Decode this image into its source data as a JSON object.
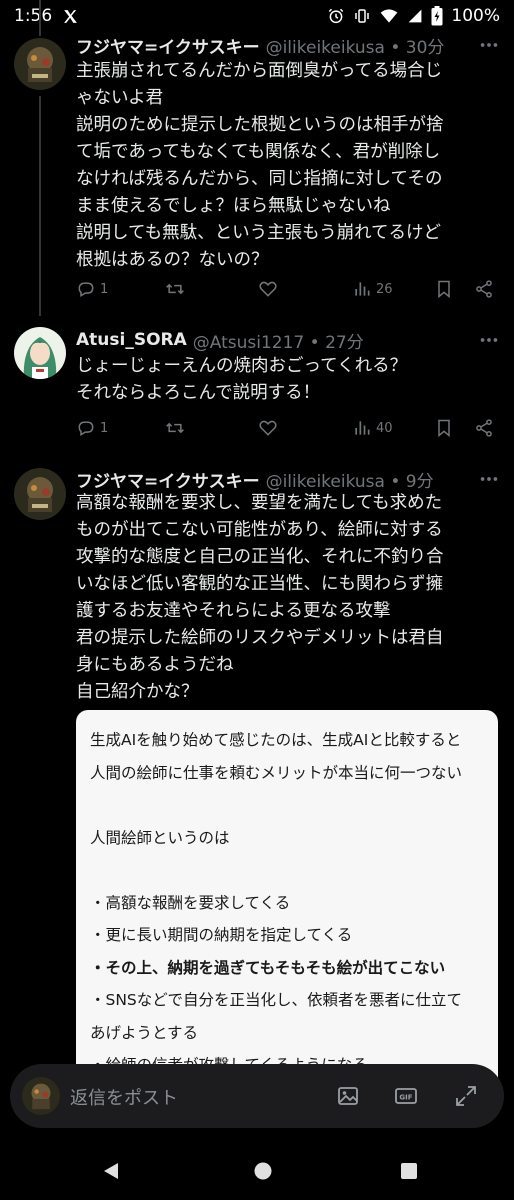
{
  "status_bar": {
    "time": "1:56",
    "battery": "100%",
    "icons": [
      "x-logo-icon",
      "alarm-icon",
      "vibrate-icon",
      "wifi-icon",
      "signal-icon",
      "battery-icon"
    ]
  },
  "tweets": [
    {
      "name": "フジヤマ=イクサスキー",
      "meta": "@ilikeikeikusa • 30分",
      "lines": [
        "主張崩されてるんだから面倒臭がってる場合じ",
        "ゃないよ君",
        "説明のために提示した根拠というのは相手が捨",
        "て垢であってもなくても関係なく、君が削除し",
        "なければ残るんだから、同じ指摘に対してその",
        "まま使えるでしょ？ほら無駄じゃないね",
        "説明しても無駄、という主張もう崩れてるけど",
        "根拠はあるの？ないの？"
      ],
      "replies": "1",
      "retweets": "",
      "likes": "",
      "views": "26"
    },
    {
      "name": "Atusi_SORA",
      "meta": "@Atsusi1217 • 27分",
      "lines": [
        "じょーじょーえんの焼肉おごってくれる？",
        "それならよろこんで説明する！"
      ],
      "replies": "1",
      "retweets": "",
      "likes": "",
      "views": "40"
    },
    {
      "name": "フジヤマ=イクサスキー",
      "meta": "@ilikeikeikusa • 9分",
      "lines": [
        "高額な報酬を要求し、要望を満たしても求めた",
        "ものが出てこない可能性があり、絵師に対する",
        "攻撃的な態度と自己の正当化、それに不釣り合",
        "いなほど低い客観的な正当性、にも関わらず擁",
        "護するお友達やそれらによる更なる攻撃",
        "君の提示した絵師のリスクやデメリットは君自",
        "身にもあるようだね",
        "自己紹介かな？"
      ]
    }
  ],
  "quote_card": {
    "lines": [
      {
        "text": "生成AIを触り始めて感じたのは、生成AIと比較すると",
        "bold": false
      },
      {
        "text": "人間の絵師に仕事を頼むメリットが本当に何一つない",
        "bold": false
      },
      {
        "text": "",
        "bold": false
      },
      {
        "text": "人間絵師というのは",
        "bold": false
      },
      {
        "text": "",
        "bold": false
      },
      {
        "text": "・高額な報酬を要求してくる",
        "bold": false
      },
      {
        "text": "・更に長い期間の納期を指定してくる",
        "bold": false
      },
      {
        "text": "・その上、納期を過ぎてもそもそも絵が出てこない",
        "bold": true
      },
      {
        "text": "・SNSなどで自分を正当化し、依頼者を悪者に仕立て",
        "bold": false
      },
      {
        "text": "あげようとする",
        "bold": false
      },
      {
        "text": "・絵師の信者が攻撃してくるようになる",
        "bold": false
      }
    ]
  },
  "reply_bar": {
    "placeholder": "返信をポスト"
  },
  "colors": {
    "background": "#000000",
    "text": "#e7e9ea",
    "muted": "#71767b",
    "card": "#f7f7f7"
  }
}
